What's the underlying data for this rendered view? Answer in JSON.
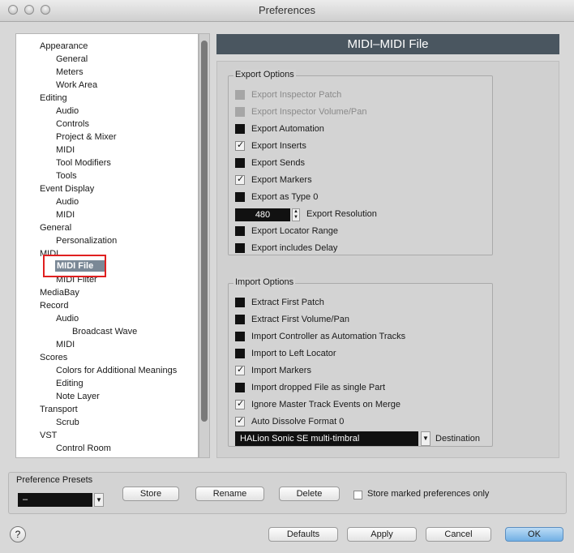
{
  "window": {
    "title": "Preferences"
  },
  "tree": {
    "items": [
      {
        "label": "Appearance",
        "level": 0
      },
      {
        "label": "General",
        "level": 1
      },
      {
        "label": "Meters",
        "level": 1
      },
      {
        "label": "Work Area",
        "level": 1
      },
      {
        "label": "Editing",
        "level": 0
      },
      {
        "label": "Audio",
        "level": 1
      },
      {
        "label": "Controls",
        "level": 1
      },
      {
        "label": "Project & Mixer",
        "level": 1
      },
      {
        "label": "MIDI",
        "level": 1
      },
      {
        "label": "Tool Modifiers",
        "level": 1
      },
      {
        "label": "Tools",
        "level": 1
      },
      {
        "label": "Event Display",
        "level": 0
      },
      {
        "label": "Audio",
        "level": 1
      },
      {
        "label": "MIDI",
        "level": 1
      },
      {
        "label": "General",
        "level": 0
      },
      {
        "label": "Personalization",
        "level": 1
      },
      {
        "label": "MIDI",
        "level": 0
      },
      {
        "label": "MIDI File",
        "level": 1,
        "selected": true
      },
      {
        "label": "MIDI Filter",
        "level": 1
      },
      {
        "label": "MediaBay",
        "level": 0
      },
      {
        "label": "Record",
        "level": 0
      },
      {
        "label": "Audio",
        "level": 1
      },
      {
        "label": "Broadcast Wave",
        "level": 2
      },
      {
        "label": "MIDI",
        "level": 1
      },
      {
        "label": "Scores",
        "level": 0
      },
      {
        "label": "Colors for Additional Meanings",
        "level": 1
      },
      {
        "label": "Editing",
        "level": 1
      },
      {
        "label": "Note Layer",
        "level": 1
      },
      {
        "label": "Transport",
        "level": 0
      },
      {
        "label": "Scrub",
        "level": 1
      },
      {
        "label": "VST",
        "level": 0
      },
      {
        "label": "Control Room",
        "level": 1
      }
    ]
  },
  "page": {
    "title": "MIDI–MIDI File"
  },
  "export": {
    "title": "Export Options",
    "options": [
      {
        "label": "Export Inspector Patch",
        "state": "disabled"
      },
      {
        "label": "Export Inspector Volume/Pan",
        "state": "disabled"
      },
      {
        "label": "Export Automation",
        "state": "off"
      },
      {
        "label": "Export Inserts",
        "state": "checked"
      },
      {
        "label": "Export Sends",
        "state": "off"
      },
      {
        "label": "Export Markers",
        "state": "checked"
      },
      {
        "label": "Export as Type 0",
        "state": "off"
      }
    ],
    "resolution_value": "480",
    "resolution_label": "Export Resolution",
    "options2": [
      {
        "label": "Export Locator Range",
        "state": "off"
      },
      {
        "label": "Export includes Delay",
        "state": "off"
      }
    ]
  },
  "import": {
    "title": "Import Options",
    "options": [
      {
        "label": "Extract First Patch",
        "state": "off"
      },
      {
        "label": "Extract First Volume/Pan",
        "state": "off"
      },
      {
        "label": "Import Controller as Automation Tracks",
        "state": "off"
      },
      {
        "label": "Import to Left Locator",
        "state": "off"
      },
      {
        "label": "Import Markers",
        "state": "checked"
      },
      {
        "label": "Import dropped File as single Part",
        "state": "off"
      },
      {
        "label": "Ignore Master Track Events on Merge",
        "state": "checked"
      },
      {
        "label": "Auto Dissolve Format 0",
        "state": "checked"
      }
    ],
    "destination_value": "HALion Sonic SE multi-timbral",
    "destination_label": "Destination"
  },
  "presets": {
    "title": "Preference Presets",
    "selected": "–",
    "store_label": "Store",
    "rename_label": "Rename",
    "delete_label": "Delete",
    "store_marked_label": "Store marked preferences only"
  },
  "footer": {
    "help_label": "?",
    "defaults_label": "Defaults",
    "apply_label": "Apply",
    "cancel_label": "Cancel",
    "ok_label": "OK"
  },
  "colors": {
    "header_bg": "#4a5660",
    "selection_bg": "#7a8896",
    "highlight": "#e02020",
    "ok_button": "#72b0e4"
  }
}
